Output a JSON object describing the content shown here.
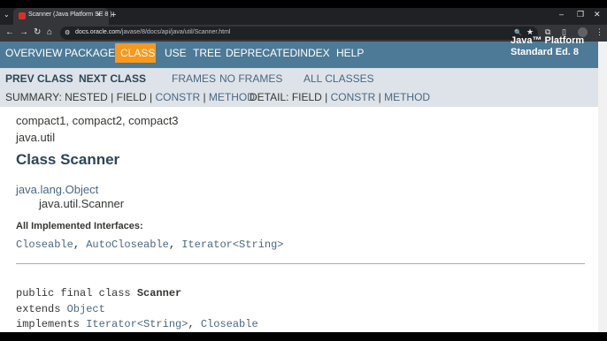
{
  "browser": {
    "tab_title": "Scanner (Java Platform SE 8 )",
    "tab_close": "×",
    "new_tab": "+",
    "url_host": "docs.oracle.com",
    "url_path": "/javase/8/docs/api/java/util/Scanner.html",
    "icons": {
      "tab_list": "chevron-down-icon",
      "back": "arrow-left-icon",
      "forward": "arrow-right-icon",
      "reload": "reload-icon",
      "home": "home-icon",
      "site_info": "tune-icon",
      "zoom": "zoom-icon",
      "bookmark": "star-icon",
      "extensions": "puzzle-icon",
      "sidepanel": "sidepanel-icon",
      "menu": "kebab-menu-icon"
    },
    "glyphs": {
      "tab_list": "⌄",
      "back": "←",
      "forward": "→",
      "reload": "↻",
      "home": "⌂",
      "site_info": "⚙",
      "zoom": "🔍",
      "bookmark": "★",
      "extensions": "⧉",
      "sidepanel": "▯",
      "menu": "⋮",
      "minimize": "–",
      "restore": "❐",
      "close": "✕"
    }
  },
  "nav": {
    "overview": "OVERVIEW",
    "package": "PACKAGE",
    "class": "CLASS",
    "use": "USE",
    "tree": "TREE",
    "deprecated": "DEPRECATED",
    "index": "INDEX",
    "help": "HELP",
    "brand_line1": "Java™ Platform",
    "brand_line2": "Standard Ed. 8"
  },
  "subnav": {
    "prev_class": "PREV CLASS",
    "next_class": "NEXT CLASS",
    "frames": "FRAMES",
    "no_frames": "NO FRAMES",
    "all_classes": "ALL CLASSES",
    "summary_label": "SUMMARY:",
    "summary_nested": "NESTED",
    "summary_field": "FIELD",
    "summary_constr": "CONSTR",
    "summary_method": "METHOD",
    "detail_label": "DETAIL:",
    "detail_field": "FIELD",
    "detail_constr": "CONSTR",
    "detail_method": "METHOD",
    "sep": " | "
  },
  "content": {
    "profiles": "compact1, compact2, compact3",
    "package": "java.util",
    "class_title": "Class Scanner",
    "super": "java.lang.Object",
    "self": "java.util.Scanner",
    "interfaces_label": "All Implemented Interfaces:",
    "interface1": "Closeable",
    "interface2": "AutoCloseable",
    "interface3": "Iterator<String>",
    "comma": ", ",
    "decl_prefix": "public final class ",
    "decl_name": "Scanner",
    "extends_kw": "extends ",
    "extends_type": "Object",
    "implements_kw": "implements ",
    "implements_type1": "Iterator<String>",
    "implements_type2": "Closeable"
  }
}
